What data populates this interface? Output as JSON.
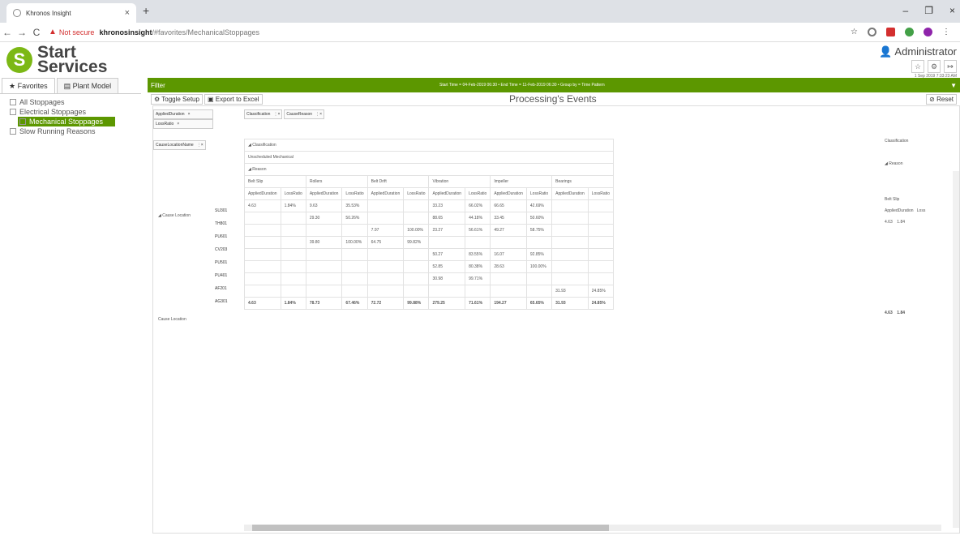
{
  "browser": {
    "tab_title": "Khronos Insight",
    "new_tab": "+",
    "not_secure": "Not secure",
    "url_host": "khronosinsight",
    "url_path": "/#favorites/MechanicalStoppages"
  },
  "header": {
    "logo_line1": "Start",
    "logo_line2": "Services",
    "user": "Administrator",
    "timestamp": "1 Sep 2019 7:33:23 AM"
  },
  "sidebar": {
    "tabs": [
      "Favorites",
      "Plant Model"
    ],
    "items": [
      "All Stoppages",
      "Electrical Stoppages",
      "Mechanical Stoppages",
      "Slow Running Reasons"
    ]
  },
  "filter": {
    "label": "Filter",
    "summary": "Start Time = 04-Feb-2019 06:30 • End Time = 11-Feb-2019 06:30 • Group by = Time Pattern"
  },
  "toolbar": {
    "toggle": "Toggle Setup",
    "export": "Export to Excel",
    "title": "Processing's Events",
    "reset": "Reset"
  },
  "pivot": {
    "value_chips": [
      "AppliedDuration",
      "LossRatio"
    ],
    "col_chips": [
      "Classification",
      "CauseReason"
    ],
    "row_chip": "CauseLocationName",
    "classification_header": "Classification",
    "classification_value": "Unscheduled Mechanical",
    "reason_header": "Reason",
    "reasons": [
      "Belt Slip",
      "Rollers",
      "Belt Drift",
      "Vibration",
      "Impeller",
      "Bearings"
    ],
    "measure_headers": [
      "AppliedDuration",
      "LossRatio"
    ],
    "row_group": "Cause Location",
    "rows": [
      {
        "loc": "SU301",
        "vals": [
          "4.63",
          "1.84%",
          "9.63",
          "35.53%",
          "",
          "",
          "33.23",
          "66.02%",
          "66.65",
          "42.69%",
          "",
          ""
        ]
      },
      {
        "loc": "TH801",
        "vals": [
          "",
          "",
          "29.30",
          "50.26%",
          "",
          "",
          "88.65",
          "44.18%",
          "33.45",
          "50.60%",
          "",
          ""
        ]
      },
      {
        "loc": "PU601",
        "vals": [
          "",
          "",
          "",
          "",
          "7.97",
          "100.00%",
          "23.27",
          "56.61%",
          "49.27",
          "58.75%",
          "",
          ""
        ]
      },
      {
        "loc": "CV203",
        "vals": [
          "",
          "",
          "39.80",
          "100.00%",
          "64.75",
          "99.82%",
          "",
          "",
          "",
          "",
          "",
          ""
        ]
      },
      {
        "loc": "PU501",
        "vals": [
          "",
          "",
          "",
          "",
          "",
          "",
          "50.27",
          "83.55%",
          "16.07",
          "92.85%",
          "",
          ""
        ]
      },
      {
        "loc": "PU401",
        "vals": [
          "",
          "",
          "",
          "",
          "",
          "",
          "52.85",
          "80.38%",
          "28.63",
          "100.00%",
          "",
          ""
        ]
      },
      {
        "loc": "AF201",
        "vals": [
          "",
          "",
          "",
          "",
          "",
          "",
          "30.98",
          "99.71%",
          "",
          "",
          "",
          ""
        ]
      },
      {
        "loc": "AG301",
        "vals": [
          "",
          "",
          "",
          "",
          "",
          "",
          "",
          "",
          "",
          "",
          "31.93",
          "24.85%"
        ]
      }
    ],
    "total_label": "Cause Location",
    "totals": [
      "4.63",
      "1.84%",
      "78.73",
      "67.46%",
      "72.72",
      "99.88%",
      "279.25",
      "71.61%",
      "194.27",
      "65.65%",
      "31.93",
      "24.85%"
    ],
    "right_panel": {
      "classification": "Classification",
      "reason": "Reason",
      "reason_value": "Belt Slip",
      "measure1": "AppliedDuration",
      "measure2": "Loss",
      "val1": "4.63",
      "val2": "1.84",
      "total1": "4.63",
      "total2": "1.84"
    }
  }
}
